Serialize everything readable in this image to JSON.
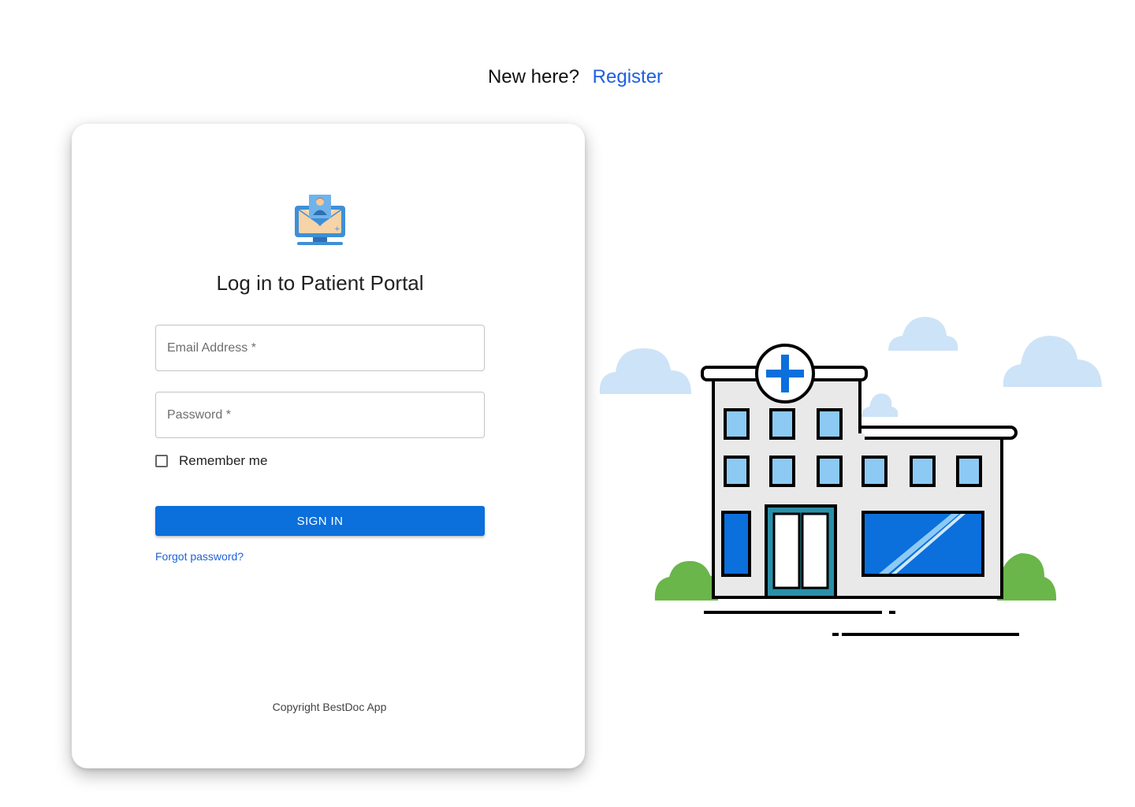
{
  "header": {
    "prompt_text": "New here?",
    "register_label": "Register"
  },
  "login": {
    "title": "Log in to Patient Portal",
    "email_placeholder": "Email Address *",
    "password_placeholder": "Password *",
    "remember_label": "Remember me",
    "signin_label": "SIGN IN",
    "forgot_label": "Forgot password?",
    "copyright": "Copyright BestDoc App"
  },
  "colors": {
    "primary": "#0b6fdc",
    "link": "#1e5fe0",
    "cloud": "#cde3f7",
    "window": "#8ccaf4",
    "bush": "#6ab64a"
  },
  "icons": {
    "logo": "patient-computer-icon",
    "illustration": "hospital-building-illustration"
  }
}
